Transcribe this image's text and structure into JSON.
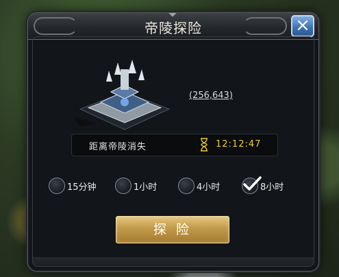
{
  "dialog": {
    "title": "帝陵探险",
    "close_icon": "close-x-icon",
    "coords": "(256,643)",
    "timer_label": "距离帝陵消失",
    "timer_value": "12:12:47",
    "options": [
      {
        "label": "15分钟",
        "selected": false
      },
      {
        "label": "1小时",
        "selected": false
      },
      {
        "label": "4小时",
        "selected": false
      },
      {
        "label": "8小时",
        "selected": true
      }
    ],
    "explore_label": "探 险"
  },
  "colors": {
    "timer": "#f0cf27",
    "button_gold": "#c19a4a",
    "close_blue": "#3b6fb0"
  }
}
